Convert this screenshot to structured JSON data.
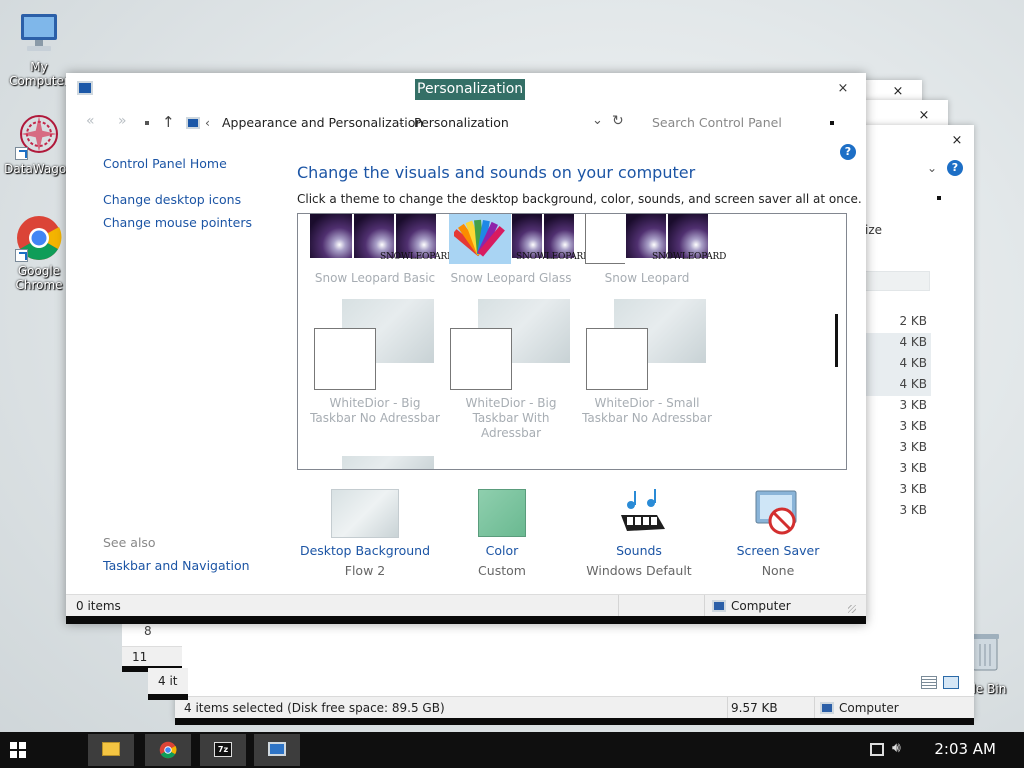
{
  "desktop": {
    "icons": [
      {
        "label": "My Computer",
        "icon": "computer-icon"
      },
      {
        "label": "DataWagon",
        "icon": "datawagon-icon"
      },
      {
        "label_line1": "Google",
        "label_line2": "Chrome",
        "icon": "chrome-icon"
      },
      {
        "label": "cle Bin",
        "icon": "recycle-bin-icon"
      }
    ]
  },
  "background_window_2": {
    "partial_header": "ize",
    "file_sizes": [
      "2 KB",
      "4 KB",
      "4 KB",
      "4 KB",
      "3 KB",
      "3 KB",
      "3 KB",
      "3 KB",
      "3 KB",
      "3 KB"
    ],
    "partial_left_1": "8",
    "partial_left_2": "11",
    "partial_left_3": "4 it",
    "status": {
      "selection": "4 items selected (Disk free space: 89.5 GB)",
      "size": "9.57 KB",
      "location": "Computer"
    }
  },
  "window": {
    "title": "Personalization",
    "close_glyph": "×",
    "address": {
      "back": "«",
      "forward": "»",
      "crumb_sep": "‹",
      "crumb1": "Appearance and Personalization",
      "crumb_dash": "-",
      "crumb2": "Personalization",
      "search_placeholder": "Search Control Panel"
    },
    "help_glyph": "?",
    "sidebar": {
      "home": "Control Panel Home",
      "links": [
        "Change desktop icons",
        "Change mouse pointers"
      ],
      "see_also_heading": "See also",
      "see_also_links": [
        "Taskbar and Navigation"
      ]
    },
    "heading": "Change the visuals and sounds on your computer",
    "subheading": "Click a theme to change the desktop background, color, sounds, and screen saver all at once.",
    "themes": [
      {
        "name": "Snow Leopard Basic",
        "brand": "SNOWLEOPARD"
      },
      {
        "name": "Snow Leopard Glass",
        "brand": "SNOWLEOPARD"
      },
      {
        "name": "Snow Leopard",
        "brand": "SNOWLEOPARD"
      },
      {
        "name_line1": "WhiteDior - Big",
        "name_line2": "Taskbar No Adressbar"
      },
      {
        "name_line1": "WhiteDior - Big",
        "name_line2": "Taskbar With",
        "name_line3": "Adressbar"
      },
      {
        "name_line1": "WhiteDior - Small",
        "name_line2": "Taskbar No Adressbar"
      }
    ],
    "bottom": [
      {
        "name": "Desktop Background",
        "value": "Flow 2"
      },
      {
        "name": "Color",
        "value": "Custom"
      },
      {
        "name": "Sounds",
        "value": "Windows Default"
      },
      {
        "name": "Screen Saver",
        "value": "None"
      }
    ],
    "status": {
      "items": "0 items",
      "location": "Computer"
    }
  },
  "taskbar": {
    "time": "2:03 AM",
    "apps": [
      "file-explorer-icon",
      "chrome-icon",
      "7zip-icon",
      "control-panel-icon"
    ]
  },
  "colors": {
    "title_highlight": "#346f66",
    "link": "#1c55a5",
    "help_blue": "#1d6fc6",
    "taskbar": "#0f0f0f"
  }
}
